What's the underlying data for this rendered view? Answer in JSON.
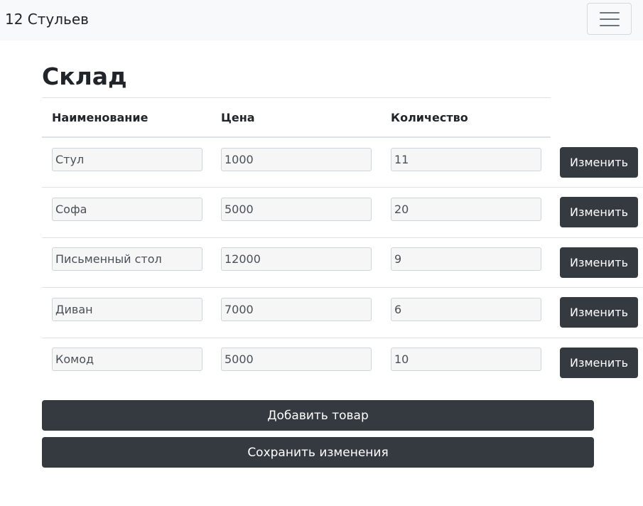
{
  "navbar": {
    "brand": "12 Стульев",
    "toggler_icon": "hamburger-menu-icon"
  },
  "page": {
    "title": "Склад"
  },
  "table": {
    "headers": [
      "Наименование",
      "Цена",
      "Количество"
    ],
    "rows": [
      {
        "name": "Стул",
        "price": "1000",
        "qty": "11",
        "action": "Изменить"
      },
      {
        "name": "Софа",
        "price": "5000",
        "qty": "20",
        "action": "Изменить"
      },
      {
        "name": "Письменный стол",
        "price": "12000",
        "qty": "9",
        "action": "Изменить"
      },
      {
        "name": "Диван",
        "price": "7000",
        "qty": "6",
        "action": "Изменить"
      },
      {
        "name": "Комод",
        "price": "5000",
        "qty": "10",
        "action": "Изменить"
      }
    ]
  },
  "actions": {
    "add_label": "Добавить товар",
    "save_label": "Сохранить изменения"
  },
  "colors": {
    "navbar_bg": "#f8f9fa",
    "button_dark": "#343a40",
    "input_bg": "#f6f6f6",
    "border": "#dee2e6"
  }
}
